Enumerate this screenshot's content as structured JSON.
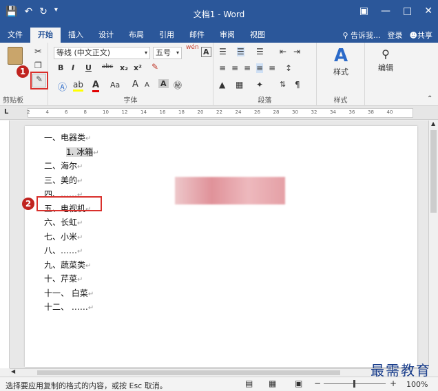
{
  "title_bar": {
    "title": "文档1 - Word",
    "qat": [
      "save-icon",
      "undo-icon",
      "redo-icon",
      "customize-icon"
    ]
  },
  "tabs": [
    "文件",
    "开始",
    "插入",
    "设计",
    "布局",
    "引用",
    "邮件",
    "审阅",
    "视图"
  ],
  "tab_active": "开始",
  "tell_me": "告诉我...",
  "login": "登录",
  "share": "共享",
  "ribbon": {
    "clipboard": {
      "label": "剪贴板",
      "paste": "粘贴"
    },
    "font": {
      "label": "字体",
      "font_name": "等线 (中文正文)",
      "font_size": "五号",
      "bold": "B",
      "italic": "I",
      "underline": "U",
      "strike": "abc",
      "sub": "x₂",
      "sup": "x²",
      "aa": "Aa",
      "grow": "A",
      "shrink": "A",
      "phonetic": "wén"
    },
    "paragraph": {
      "label": "段落"
    },
    "styles": {
      "label": "样式",
      "name": "样式"
    },
    "editing": {
      "name": "编辑"
    }
  },
  "ruler_numbers": [
    "2",
    "4",
    "6",
    "8",
    "10",
    "12",
    "14",
    "16",
    "18",
    "20",
    "22",
    "24",
    "26",
    "28",
    "30",
    "32",
    "34",
    "36",
    "38",
    "40"
  ],
  "doc_lines": [
    {
      "text": "一、电器类"
    },
    {
      "text": "1.    冰箱"
    },
    {
      "text": "二、海尔"
    },
    {
      "text": "三、美的"
    },
    {
      "text": "四、……"
    },
    {
      "text": "五、电视机"
    },
    {
      "text": "六、长虹"
    },
    {
      "text": "七、小米"
    },
    {
      "text": "八、……"
    },
    {
      "text": "九、蔬菜类"
    },
    {
      "text": "十、芹菜"
    },
    {
      "text": "十一、    白菜"
    },
    {
      "text": "十二、    ……"
    }
  ],
  "status": {
    "text": "选择要应用复制的格式的内容，或按 Esc 取消。",
    "zoom": "100%"
  },
  "callouts": [
    "1",
    "2"
  ],
  "watermark": "最需教育"
}
